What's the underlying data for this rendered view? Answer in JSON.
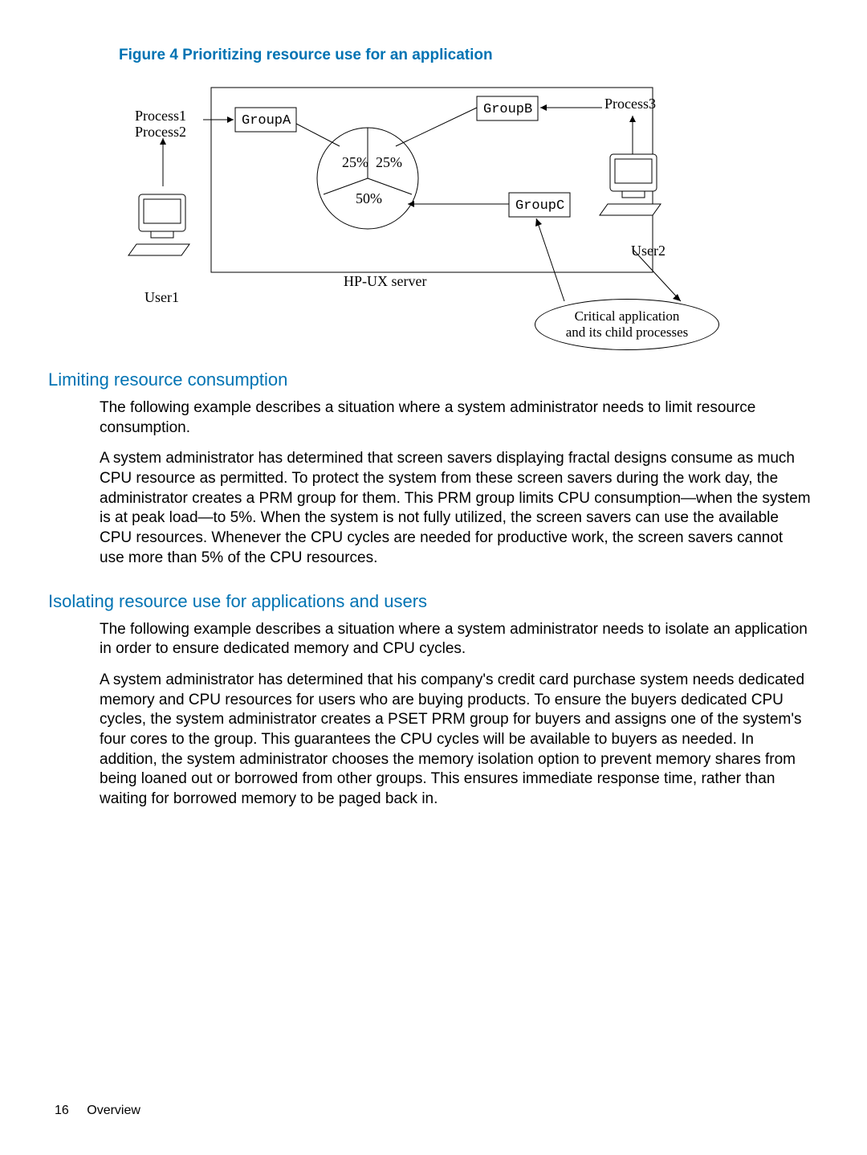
{
  "figure": {
    "caption": "Figure 4 Prioritizing resource use for an application",
    "labels": {
      "process1": "Process1",
      "process2": "Process2",
      "process3": "Process3",
      "groupA": "GroupA",
      "groupB": "GroupB",
      "groupC": "GroupC",
      "pct25a": "25%",
      "pct25b": "25%",
      "pct50": "50%",
      "server": "HP-UX server",
      "user1": "User1",
      "user2": "User2",
      "critical1": "Critical application",
      "critical2": "and its child processes"
    }
  },
  "sections": {
    "s1": {
      "heading": "Limiting resource consumption",
      "p1": "The following example describes a situation where a system administrator needs to limit resource consumption.",
      "p2": "A system administrator has determined that screen savers displaying fractal designs consume as much CPU resource as permitted. To protect the system from these screen savers during the work day, the administrator creates a PRM group for them. This PRM group limits CPU consumption—when the system is at peak load—to 5%. When the system is not fully utilized, the screen savers can use the available CPU resources. Whenever the CPU cycles are needed for productive work, the screen savers cannot use more than 5% of the CPU resources."
    },
    "s2": {
      "heading": "Isolating resource use for applications and users",
      "p1": "The following example describes a situation where a system administrator needs to isolate an application in order to ensure dedicated memory and CPU cycles.",
      "p2": "A system administrator has determined that his company's credit card purchase system needs dedicated memory and CPU resources for users who are buying products. To ensure the buyers dedicated CPU cycles, the system administrator creates a PSET PRM group for buyers and assigns one of the system's four cores to the group. This guarantees the CPU cycles will be available to buyers as needed. In addition, the system administrator chooses the memory isolation option to prevent memory shares from being loaned out or borrowed from other groups. This ensures immediate response time, rather than waiting for borrowed memory to be paged back in."
    }
  },
  "footer": {
    "page": "16",
    "section": "Overview"
  },
  "chart_data": {
    "type": "pie",
    "title": "HP-UX server",
    "slices": [
      {
        "label": "GroupA",
        "value": 25
      },
      {
        "label": "GroupB",
        "value": 25
      },
      {
        "label": "GroupC",
        "value": 50
      }
    ],
    "annotations": [
      {
        "target": "GroupA",
        "source": "User1 (Process1, Process2)"
      },
      {
        "target": "GroupB",
        "source": "User2 (Process3)"
      },
      {
        "target": "GroupC",
        "source": "Critical application and its child processes"
      }
    ]
  }
}
